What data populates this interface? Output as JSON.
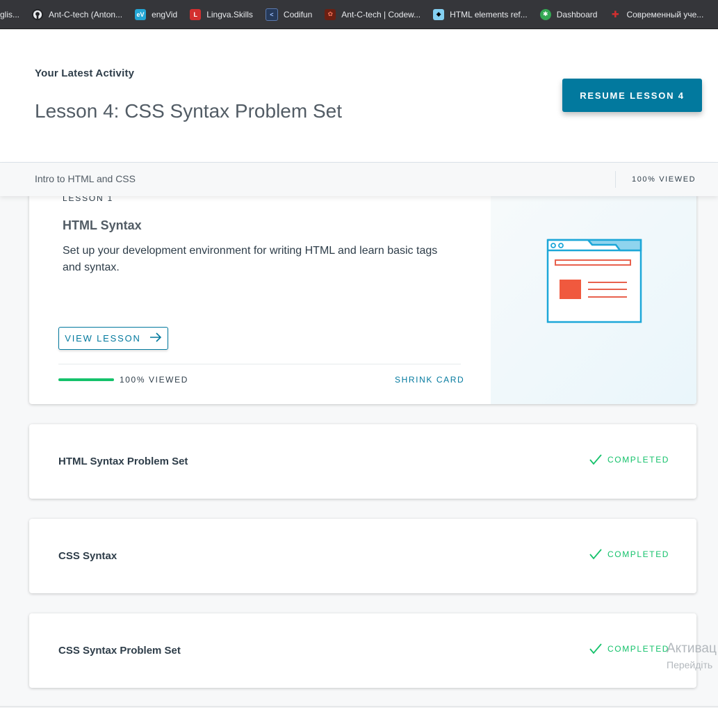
{
  "bookmarks": [
    {
      "label": "glis...",
      "icon": "bookmark-icon",
      "color": "#5f6368"
    },
    {
      "label": "Ant-C-tech (Anton...",
      "icon": "github-icon",
      "color": "#202124"
    },
    {
      "label": "engVid",
      "icon": "engvid-icon",
      "color": "#23a6d5"
    },
    {
      "label": "Lingva.Skills",
      "icon": "lingva-icon",
      "color": "#d32f2f"
    },
    {
      "label": "Codifun",
      "icon": "codifun-icon",
      "color": "#1565c0"
    },
    {
      "label": "Ant-C-tech | Codew...",
      "icon": "codewars-icon",
      "color": "#b1361e"
    },
    {
      "label": "HTML elements ref...",
      "icon": "mdn-icon",
      "color": "#83d0f2"
    },
    {
      "label": "Dashboard",
      "icon": "dashboard-icon",
      "color": "#34a853"
    },
    {
      "label": "Современный уче...",
      "icon": "javascript-info-icon",
      "color": "#c62828"
    }
  ],
  "header": {
    "activity_label": "Your Latest Activity",
    "lesson_title": "Lesson 4: CSS Syntax Problem Set",
    "resume_button": "RESUME LESSON 4"
  },
  "subbar": {
    "course": "Intro to HTML and CSS",
    "viewed": "100% VIEWED"
  },
  "lesson_card": {
    "number": "LESSON 1",
    "title": "HTML Syntax",
    "description": "Set up your development environment for writing HTML and learn basic tags and syntax.",
    "view_button": "VIEW LESSON",
    "progress_fraction": 1.0,
    "viewed": "100% VIEWED",
    "shrink": "SHRINK CARD",
    "illustration_icon": "browser-window-icon"
  },
  "cards": [
    {
      "name": "HTML Syntax Problem Set",
      "status": "COMPLETED"
    },
    {
      "name": "CSS Syntax",
      "status": "COMPLETED"
    },
    {
      "name": "CSS Syntax Problem Set",
      "status": "COMPLETED"
    }
  ],
  "watermark": {
    "line1": "Активац",
    "line2": "Перейдіть"
  },
  "colors": {
    "accent": "#02799e",
    "success": "#15c26b"
  }
}
